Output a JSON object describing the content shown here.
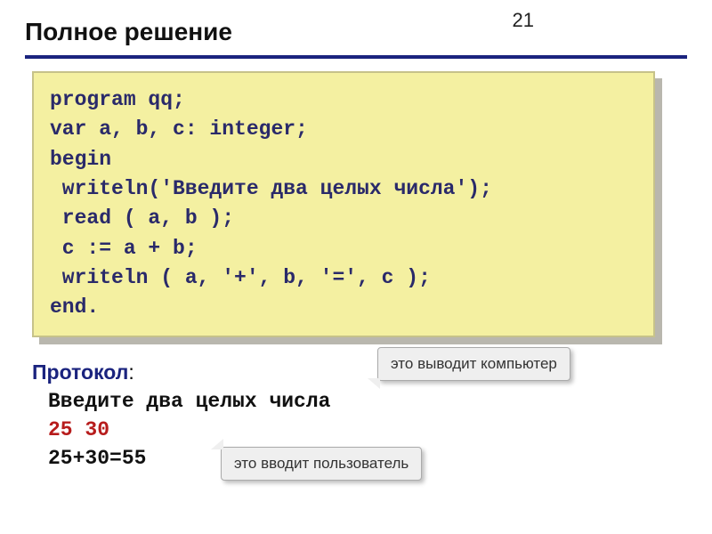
{
  "page_number": "21",
  "title": "Полное решение",
  "code": {
    "l1": "program qq;",
    "l2": "var a, b, c: integer;",
    "l3": "begin",
    "l4": " writeln('Введите два целых числа');",
    "l5": " read ( a, b );",
    "l6": " c := a + b;",
    "l7": " writeln ( a, '+', b, '=', c );",
    "l8": "end."
  },
  "protocol": {
    "label": "Протокол",
    "colon": ":",
    "prompt": "Введите два целых числа",
    "input": "25 30",
    "result": "25+30=55"
  },
  "callouts": {
    "computer": "это выводит компьютер",
    "user": "это вводит пользователь"
  }
}
